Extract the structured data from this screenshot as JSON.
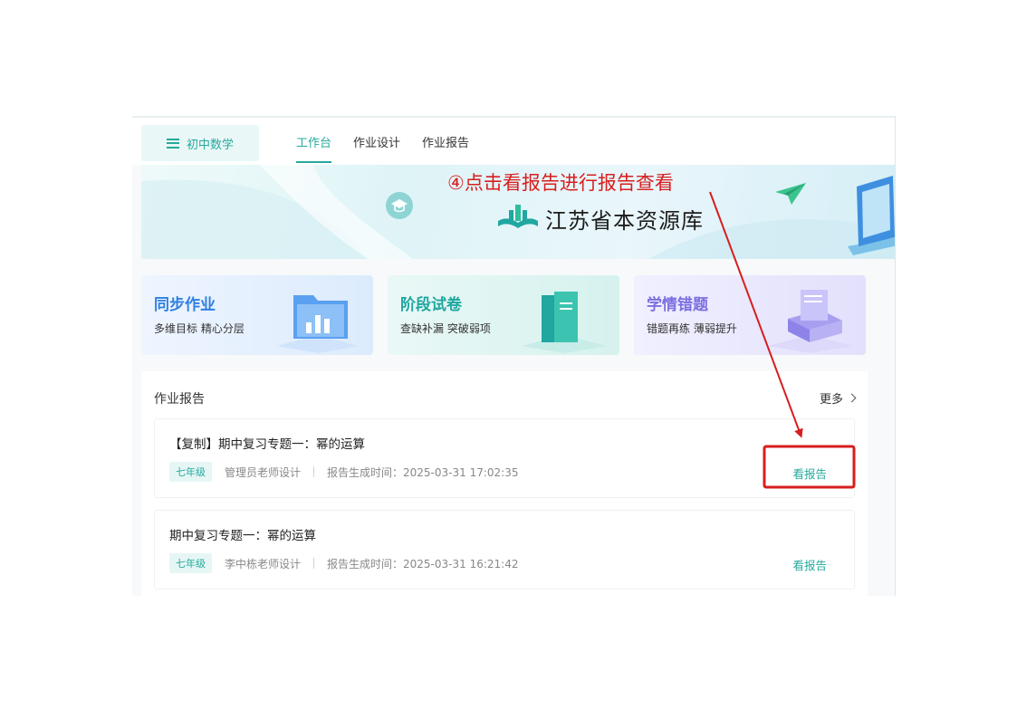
{
  "header": {
    "subject_label": "初中数学",
    "tabs": [
      {
        "label": "工作台",
        "active": true
      },
      {
        "label": "作业设计",
        "active": false
      },
      {
        "label": "作业报告",
        "active": false
      }
    ]
  },
  "banner": {
    "annotation": "④点击看报告进行报告查看",
    "title": "江苏省本资源库"
  },
  "cards": [
    {
      "title": "同步作业",
      "subtitle": "多维目标 精心分层",
      "color": "#2f7fe0"
    },
    {
      "title": "阶段试卷",
      "subtitle": "查缺补漏 突破弱项",
      "color": "#1fa7a0"
    },
    {
      "title": "学情错题",
      "subtitle": "错题再练 薄弱提升",
      "color": "#7b6fe0"
    }
  ],
  "reports_panel": {
    "title": "作业报告",
    "more_label": "更多",
    "items": [
      {
        "name": "【复制】期中复习专题一：幂的运算",
        "grade": "七年级",
        "designer": "管理员老师设计",
        "time": "报告生成时间：2025-03-31 17:02:35",
        "action": "看报告",
        "highlighted": true
      },
      {
        "name": "期中复习专题一：幂的运算",
        "grade": "七年级",
        "designer": "李中栋老师设计",
        "time": "报告生成时间：2025-03-31 16:21:42",
        "action": "看报告",
        "highlighted": false
      }
    ]
  },
  "colors": {
    "accent": "#26a99c",
    "annotation": "#d81e1e"
  }
}
